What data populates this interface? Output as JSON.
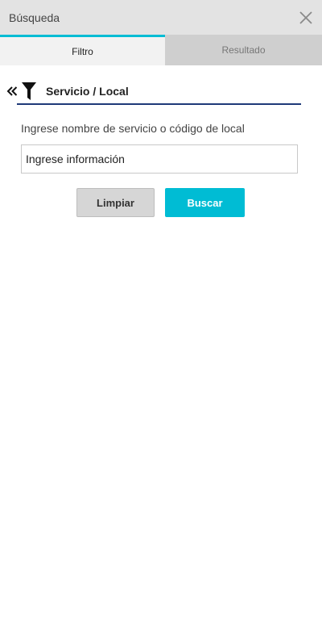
{
  "header": {
    "title": "Búsqueda",
    "close_icon": "close-icon"
  },
  "tabs": [
    {
      "label": "Filtro",
      "active": true
    },
    {
      "label": "Resultado",
      "active": false
    }
  ],
  "section": {
    "title": "Servicio / Local",
    "collapse_icon": "double-chevron-left-icon",
    "filter_icon": "filter-icon"
  },
  "form": {
    "label": "Ingrese nombre de servicio o código de local",
    "placeholder": "Ingrese información",
    "value": ""
  },
  "buttons": {
    "clear_label": "Limpiar",
    "search_label": "Buscar"
  },
  "colors": {
    "accent": "#00bcd4",
    "section_line": "#1f3a78",
    "header_bg": "#e3e3e3"
  }
}
